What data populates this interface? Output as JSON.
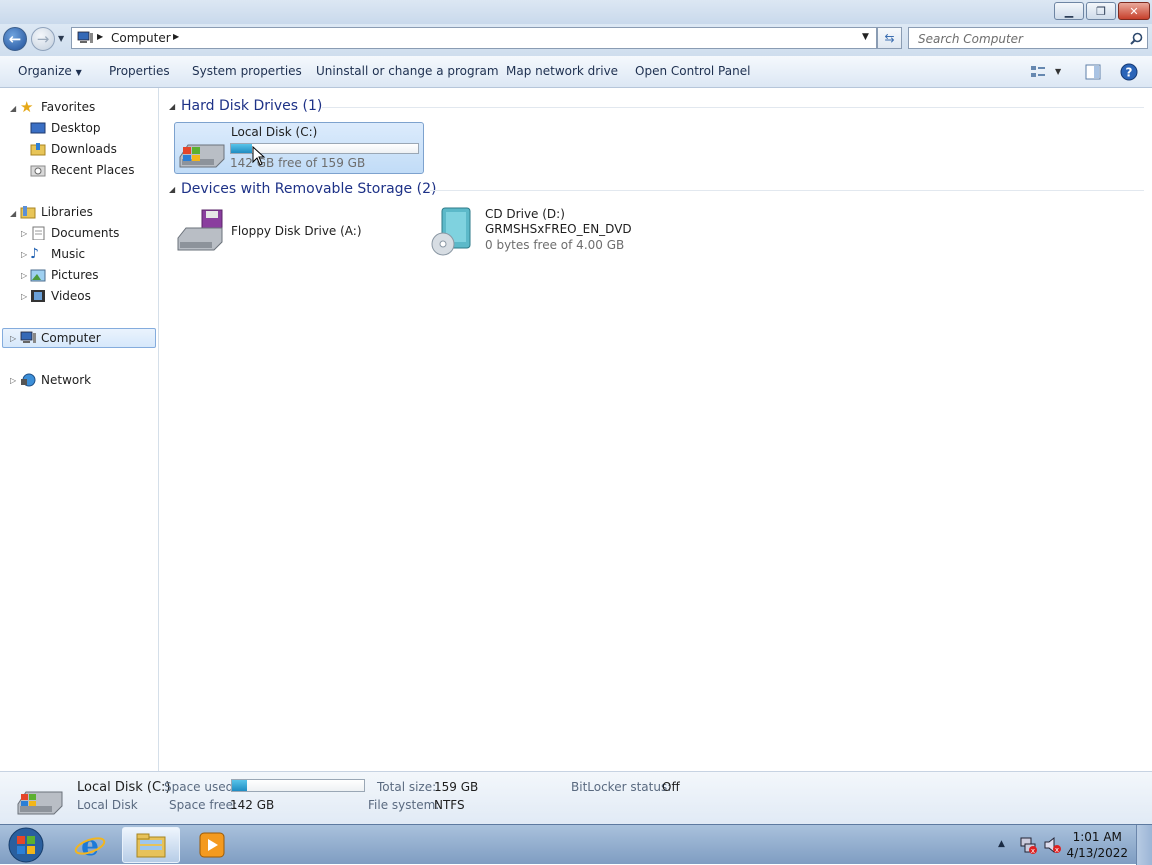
{
  "address": {
    "crumbs": [
      "Computer"
    ]
  },
  "search": {
    "placeholder": "Search Computer"
  },
  "toolbar": {
    "organize": "Organize",
    "properties": "Properties",
    "system_properties": "System properties",
    "uninstall": "Uninstall or change a program",
    "map_drive": "Map network drive",
    "control_panel": "Open Control Panel"
  },
  "nav": {
    "favorites": "Favorites",
    "desktop": "Desktop",
    "downloads": "Downloads",
    "recent": "Recent Places",
    "libraries": "Libraries",
    "documents": "Documents",
    "music": "Music",
    "pictures": "Pictures",
    "videos": "Videos",
    "computer": "Computer",
    "network": "Network"
  },
  "groups": {
    "hdd_header": "Hard Disk Drives (1)",
    "removable_header": "Devices with Removable Storage (2)"
  },
  "drives": {
    "c": {
      "name": "Local Disk (C:)",
      "free_text": "142 GB free of 159 GB",
      "used_fraction": 0.11
    },
    "a": {
      "name": "Floppy Disk Drive (A:)"
    },
    "d": {
      "name": "CD Drive (D:)",
      "label": "GRMSHSxFREO_EN_DVD",
      "free_text": "0 bytes free of 4.00 GB"
    }
  },
  "details": {
    "name": "Local Disk (C:)",
    "type": "Local Disk",
    "space_used_label": "Space used:",
    "space_free_label": "Space free:",
    "space_free": "142 GB",
    "total_size_label": "Total size:",
    "total_size": "159 GB",
    "file_system_label": "File system:",
    "file_system": "NTFS",
    "bitlocker_label": "BitLocker status:",
    "bitlocker": "Off",
    "used_fraction": 0.11
  },
  "clock": {
    "time": "1:01 AM",
    "date": "4/13/2022"
  },
  "colors": {
    "accent": "#1e3287",
    "bar_fill": "#1f8cc2",
    "selection": "#c1dcf7"
  }
}
